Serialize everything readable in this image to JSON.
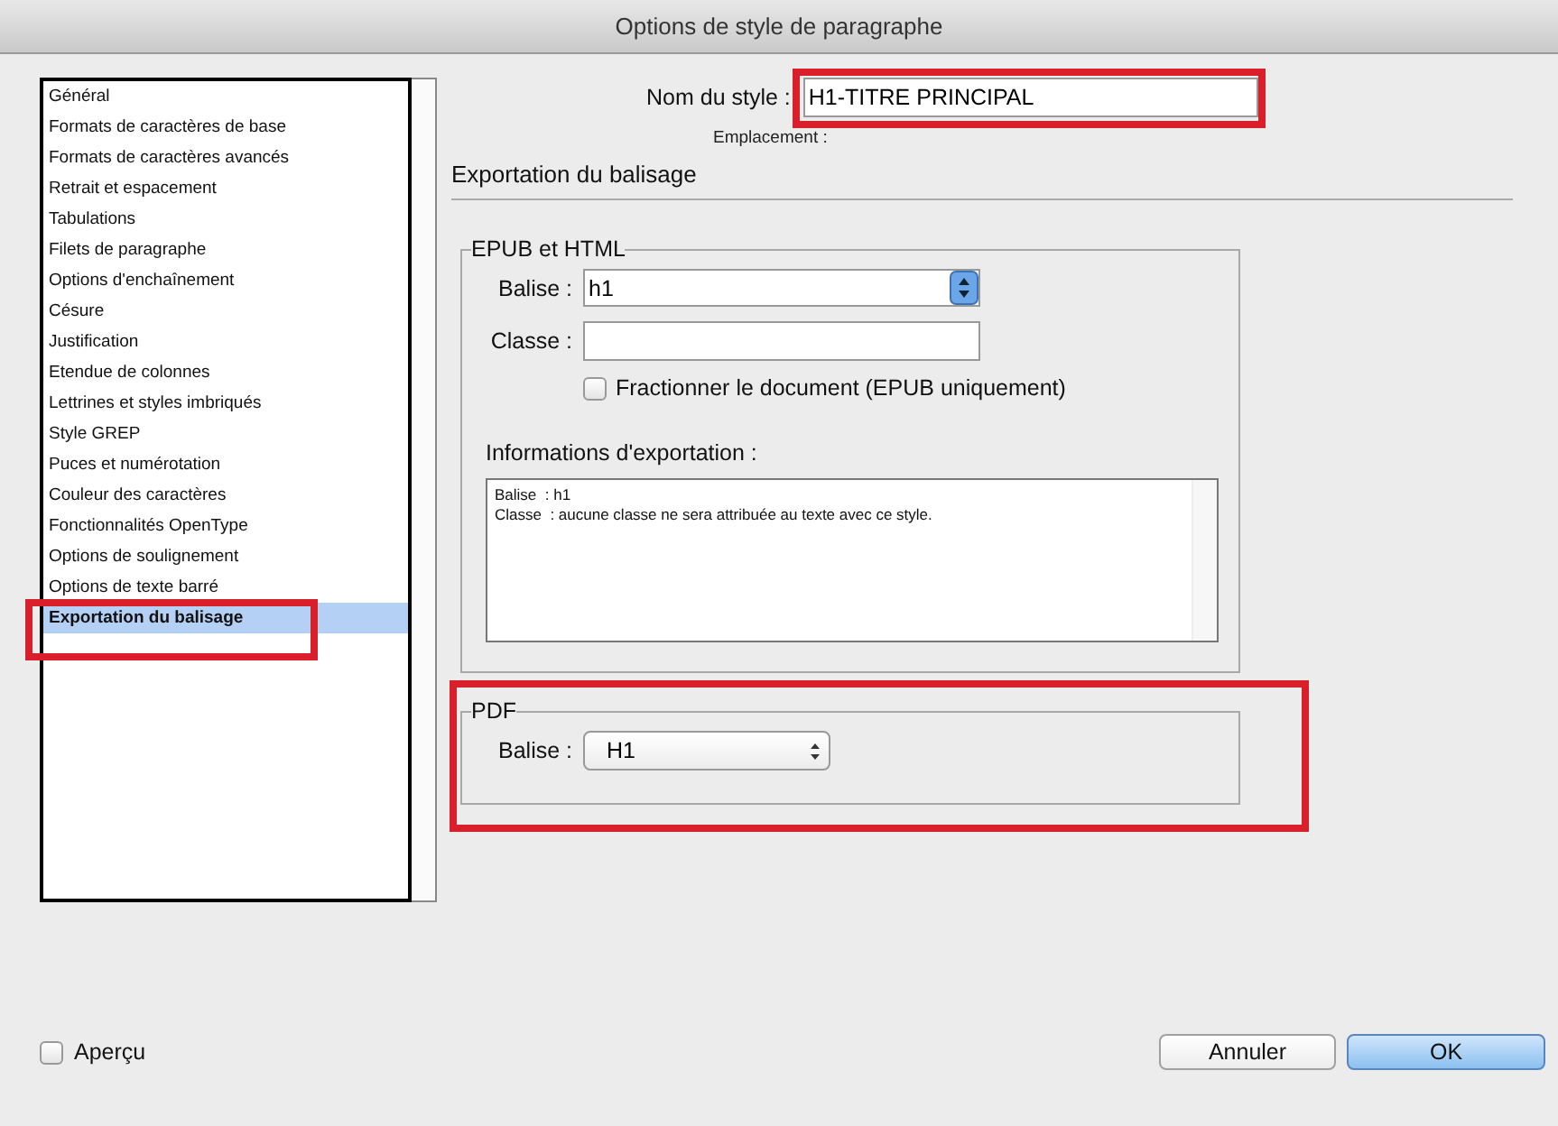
{
  "window": {
    "title": "Options de style de paragraphe"
  },
  "sidebar": {
    "items": [
      {
        "label": "Général",
        "selected": false,
        "highlighted": false
      },
      {
        "label": "Formats de caractères de base",
        "selected": false,
        "highlighted": false
      },
      {
        "label": "Formats de caractères avancés",
        "selected": false,
        "highlighted": false
      },
      {
        "label": "Retrait et espacement",
        "selected": false,
        "highlighted": false
      },
      {
        "label": "Tabulations",
        "selected": false,
        "highlighted": false
      },
      {
        "label": "Filets de paragraphe",
        "selected": false,
        "highlighted": false
      },
      {
        "label": "Options d'enchaînement",
        "selected": false,
        "highlighted": false
      },
      {
        "label": "Césure",
        "selected": false,
        "highlighted": false
      },
      {
        "label": "Justification",
        "selected": false,
        "highlighted": false
      },
      {
        "label": "Etendue de colonnes",
        "selected": false,
        "highlighted": false
      },
      {
        "label": "Lettrines et styles imbriqués",
        "selected": false,
        "highlighted": false
      },
      {
        "label": "Style GREP",
        "selected": false,
        "highlighted": false
      },
      {
        "label": "Puces et numérotation",
        "selected": false,
        "highlighted": false
      },
      {
        "label": "Couleur des caractères",
        "selected": false,
        "highlighted": false
      },
      {
        "label": "Fonctionnalités OpenType",
        "selected": false,
        "highlighted": false
      },
      {
        "label": "Options de soulignement",
        "selected": false,
        "highlighted": false
      },
      {
        "label": "Options de texte barré",
        "selected": false,
        "highlighted": false
      },
      {
        "label": "Exportation du balisage",
        "selected": true,
        "highlighted": true
      }
    ]
  },
  "style_name": {
    "label": "Nom du style :",
    "value": "H1-TITRE PRINCIPAL",
    "highlighted": true
  },
  "location": {
    "label": "Emplacement :"
  },
  "section": {
    "title": "Exportation du balisage"
  },
  "epub_html": {
    "title": "EPUB et HTML",
    "tag": {
      "label": "Balise :",
      "value": "h1"
    },
    "class": {
      "label": "Classe :"
    },
    "split": {
      "label": "Fractionner le document (EPUB uniquement)",
      "checked": false
    },
    "info": {
      "label": "Informations d'exportation :",
      "lines": [
        "Balise  : h1",
        "Classe  : aucune classe ne sera attribuée au texte avec ce style."
      ]
    }
  },
  "pdf": {
    "title": "PDF",
    "highlighted": true,
    "tag": {
      "label": "Balise :",
      "value": "H1"
    }
  },
  "preview": {
    "label": "Aperçu",
    "checked": false
  },
  "buttons": [
    {
      "label": "Annuler",
      "kind": "secondary"
    },
    {
      "label": "OK",
      "kind": "default"
    }
  ]
}
